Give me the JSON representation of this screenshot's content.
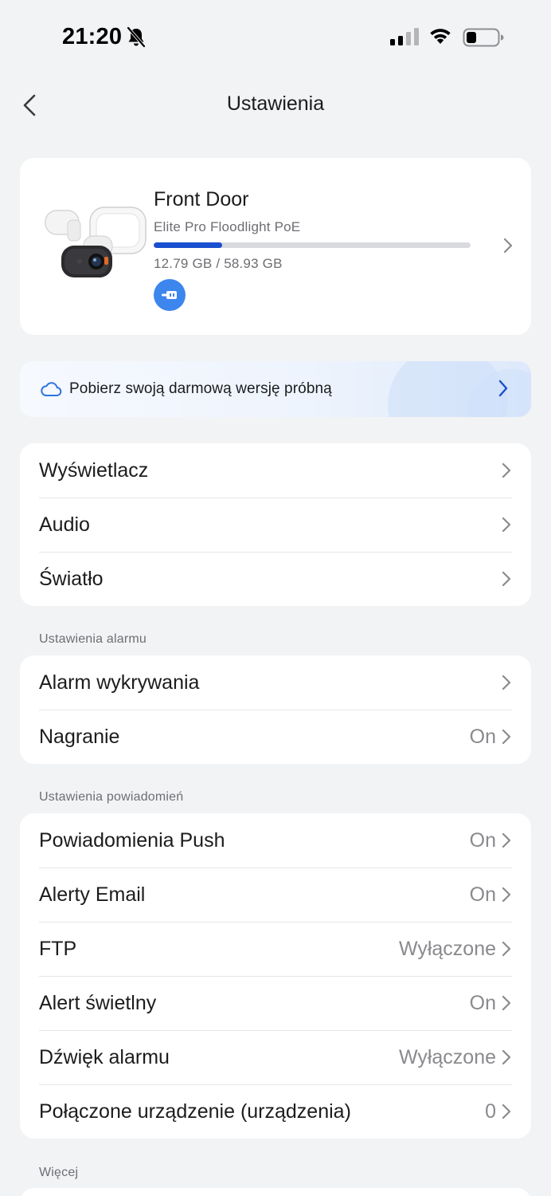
{
  "status_bar": {
    "time": "21:20"
  },
  "nav": {
    "title": "Ustawienia"
  },
  "device": {
    "name": "Front Door",
    "model": "Elite Pro Floodlight PoE",
    "storage_text": "12.79 GB / 58.93 GB",
    "storage_used_fraction": 0.217
  },
  "promo": {
    "text": "Pobierz swoją darmową wersję próbną"
  },
  "general": [
    {
      "label": "Wyświetlacz",
      "value": ""
    },
    {
      "label": "Audio",
      "value": ""
    },
    {
      "label": "Światło",
      "value": ""
    }
  ],
  "alarm_section": {
    "header": "Ustawienia alarmu",
    "items": [
      {
        "label": "Alarm wykrywania",
        "value": ""
      },
      {
        "label": "Nagranie",
        "value": "On"
      }
    ]
  },
  "notification_section": {
    "header": "Ustawienia powiadomień",
    "items": [
      {
        "label": "Powiadomienia Push",
        "value": "On"
      },
      {
        "label": "Alerty Email",
        "value": "On"
      },
      {
        "label": "FTP",
        "value": "Wyłączone"
      },
      {
        "label": "Alert świetlny",
        "value": "On"
      },
      {
        "label": "Dźwięk alarmu",
        "value": "Wyłączone"
      },
      {
        "label": "Połączone urządzenie (urządzenia)",
        "value": "0"
      }
    ]
  },
  "more_section": {
    "header": "Więcej"
  },
  "colors": {
    "accent": "#1a4fd0",
    "badge": "#3d86ee",
    "background": "#f2f3f5"
  }
}
